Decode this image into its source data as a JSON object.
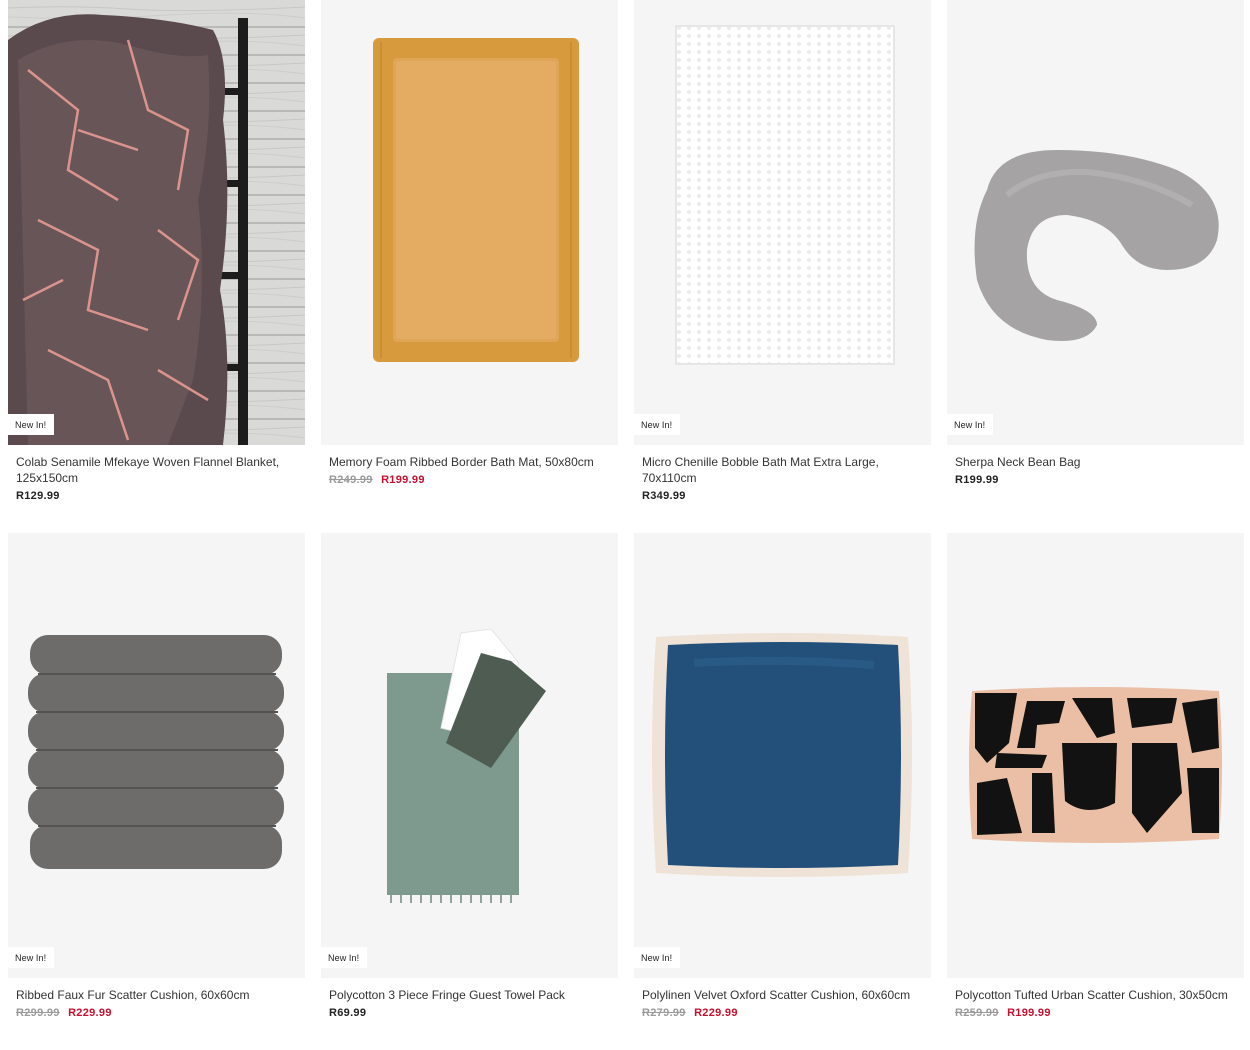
{
  "colors": {
    "sale": "#c8102e",
    "old_price": "#9a9a9a",
    "text": "#222222",
    "card_bg": "#f5f5f5"
  },
  "products": [
    {
      "name": "Colab Senamile Mfekaye Woven Flannel Blanket, 125x150cm",
      "badge": "New In!",
      "price": "R129.99",
      "old_price": null,
      "sale_price": null,
      "image": "patterned-blanket-on-ladder"
    },
    {
      "name": "Memory Foam Ribbed Border Bath Mat, 50x80cm",
      "badge": null,
      "price": null,
      "old_price": "R249.99",
      "sale_price": "R199.99",
      "image": "mustard-bath-mat"
    },
    {
      "name": "Micro Chenille Bobble Bath Mat Extra Large, 70x110cm",
      "badge": "New In!",
      "price": "R349.99",
      "old_price": null,
      "sale_price": null,
      "image": "white-chenille-bath-mat"
    },
    {
      "name": "Sherpa Neck Bean Bag",
      "badge": "New In!",
      "price": "R199.99",
      "old_price": null,
      "sale_price": null,
      "image": "grey-sherpa-neck-pillow"
    },
    {
      "name": "Ribbed Faux Fur Scatter Cushion, 60x60cm",
      "badge": "New In!",
      "price": null,
      "old_price": "R299.99",
      "sale_price": "R229.99",
      "image": "grey-ribbed-fur-cushion"
    },
    {
      "name": "Polycotton 3 Piece Fringe Guest Towel Pack",
      "badge": "New In!",
      "price": "R69.99",
      "old_price": null,
      "sale_price": null,
      "image": "sage-guest-towels"
    },
    {
      "name": "Polylinen Velvet Oxford Scatter Cushion, 60x60cm",
      "badge": "New In!",
      "price": null,
      "old_price": "R279.99",
      "sale_price": "R229.99",
      "image": "navy-velvet-cushion"
    },
    {
      "name": "Polycotton Tufted Urban Scatter Cushion, 30x50cm",
      "badge": null,
      "price": null,
      "old_price": "R259.99",
      "sale_price": "R199.99",
      "image": "tufted-abstract-cushion"
    }
  ]
}
